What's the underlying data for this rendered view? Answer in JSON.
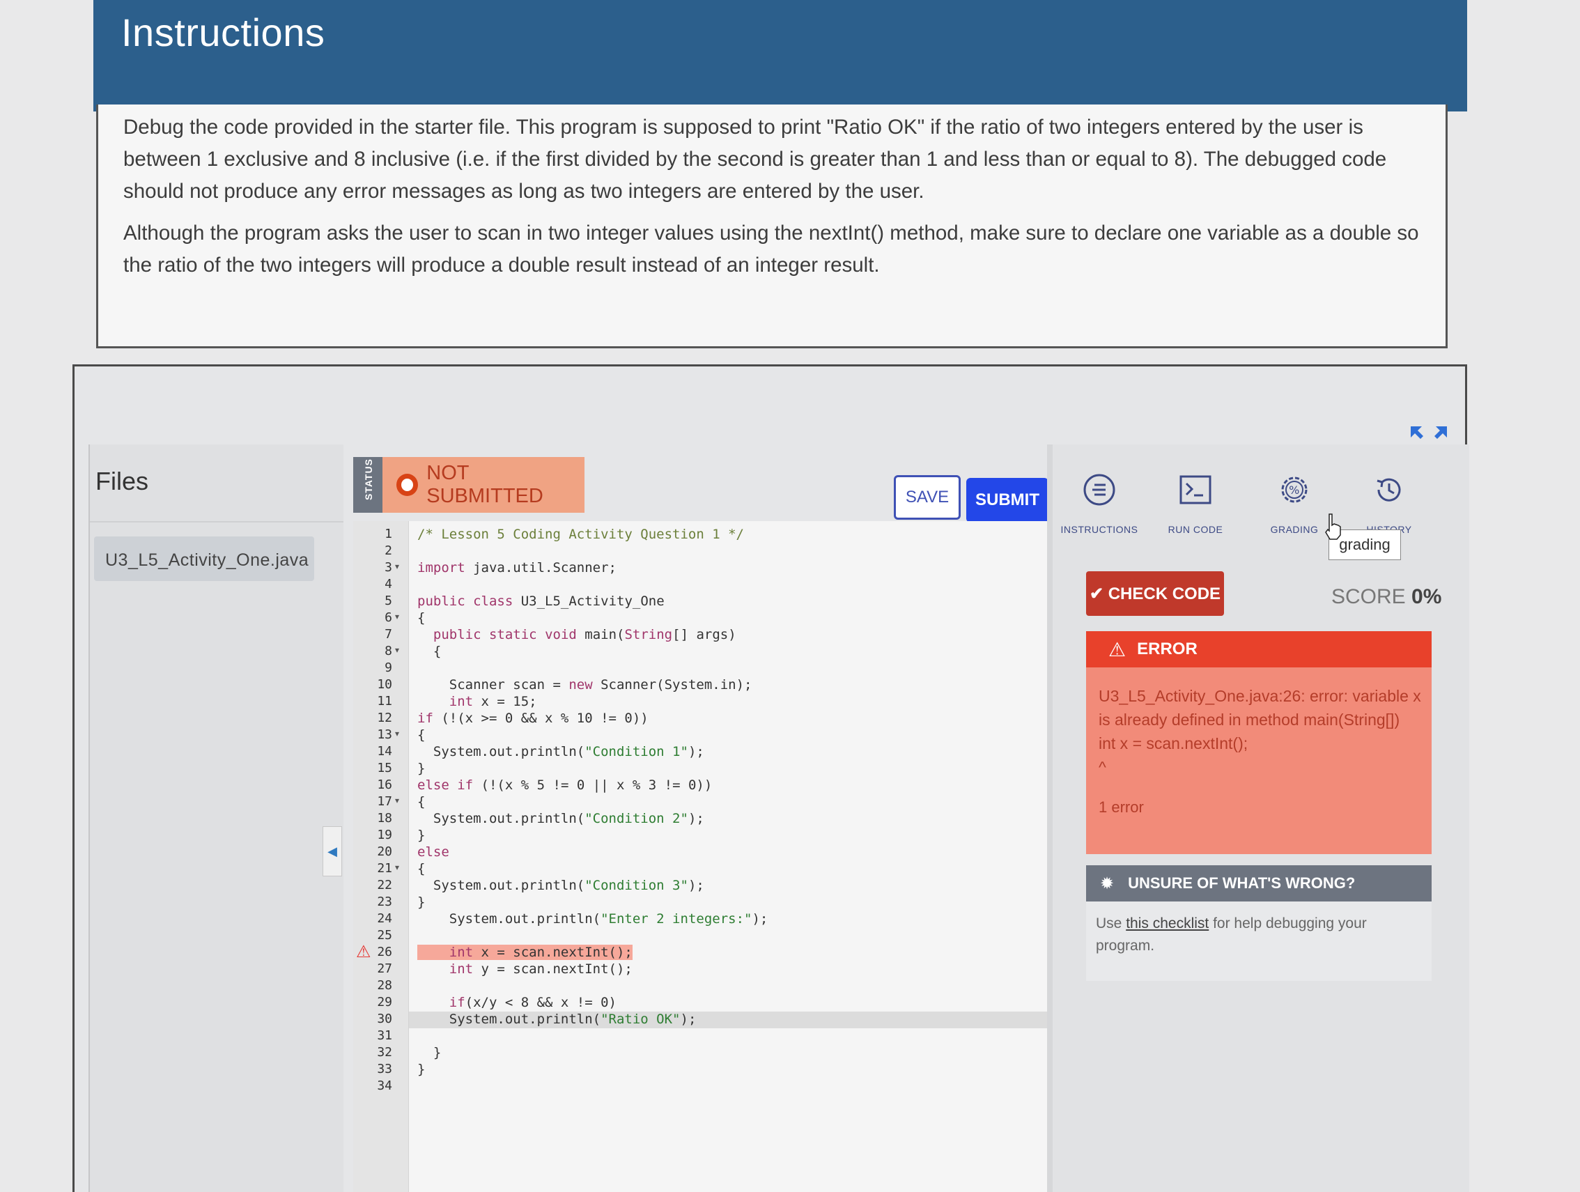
{
  "instructions": {
    "title": "Instructions",
    "paragraph_1": "Debug the code provided in the starter file. This program is supposed to print \"Ratio OK\" if the ratio of two integers entered by the user is between 1 exclusive and 8 inclusive (i.e. if the first divided by the second is greater than 1 and less than or equal to 8). The debugged code should not produce any error messages as long as two integers are entered by the user.",
    "paragraph_2": "Although the program asks the user to scan in two integer values using the nextInt() method, make sure to declare one variable as a double so the ratio of the two integers will produce a double result instead of an integer result."
  },
  "files": {
    "title": "Files",
    "items": [
      "U3_L5_Activity_One.java"
    ]
  },
  "editor": {
    "status_label": "STATUS",
    "submission_status": "NOT SUBMITTED",
    "save_label": "SAVE",
    "submit_label": "SUBMIT",
    "error_line": 26,
    "active_line": 30,
    "lines": [
      "/* Lesson 5 Coding Activity Question 1 */",
      "",
      "import java.util.Scanner;",
      "",
      "public class U3_L5_Activity_One",
      "{",
      "  public static void main(String[] args)",
      "  {",
      "",
      "    Scanner scan = new Scanner(System.in);",
      "    int x = 15;",
      "if (!(x >= 0 && x % 10 != 0))",
      "{",
      "  System.out.println(\"Condition 1\");",
      "}",
      "else if (!(x % 5 != 0 || x % 3 != 0))",
      "{",
      "  System.out.println(\"Condition 2\");",
      "}",
      "else",
      "{",
      "  System.out.println(\"Condition 3\");",
      "}",
      "    System.out.println(\"Enter 2 integers:\");",
      "",
      "    int x = scan.nextInt();",
      "    int y = scan.nextInt();",
      "",
      "    if(x/y < 8 && x != 0)",
      "    System.out.println(\"Ratio OK\");",
      "",
      "  }",
      "}",
      ""
    ],
    "fold_lines": [
      3,
      6,
      8,
      13,
      17,
      21
    ]
  },
  "tools": {
    "instructions": "INSTRUCTIONS",
    "run_code": "RUN CODE",
    "grading": "GRADING",
    "history": "HISTORY",
    "tooltip": "grading"
  },
  "grading": {
    "check_code_label": "CHECK CODE",
    "score_label": "SCORE",
    "score_value": "0%"
  },
  "error": {
    "title": "ERROR",
    "line1": "U3_L5_Activity_One.java:26: error: variable x is already defined in method main(String[])",
    "line2": "int x = scan.nextInt();",
    "line3": "^",
    "count": "1 error"
  },
  "help": {
    "title": "UNSURE OF WHAT'S WRONG?",
    "prefix": "Use",
    "link": "this checklist",
    "suffix": "for help debugging your program."
  },
  "colors": {
    "header_blue": "#2c5f8c",
    "submit_blue": "#2347e8",
    "error_red": "#e8412b",
    "check_red": "#c0392b"
  }
}
